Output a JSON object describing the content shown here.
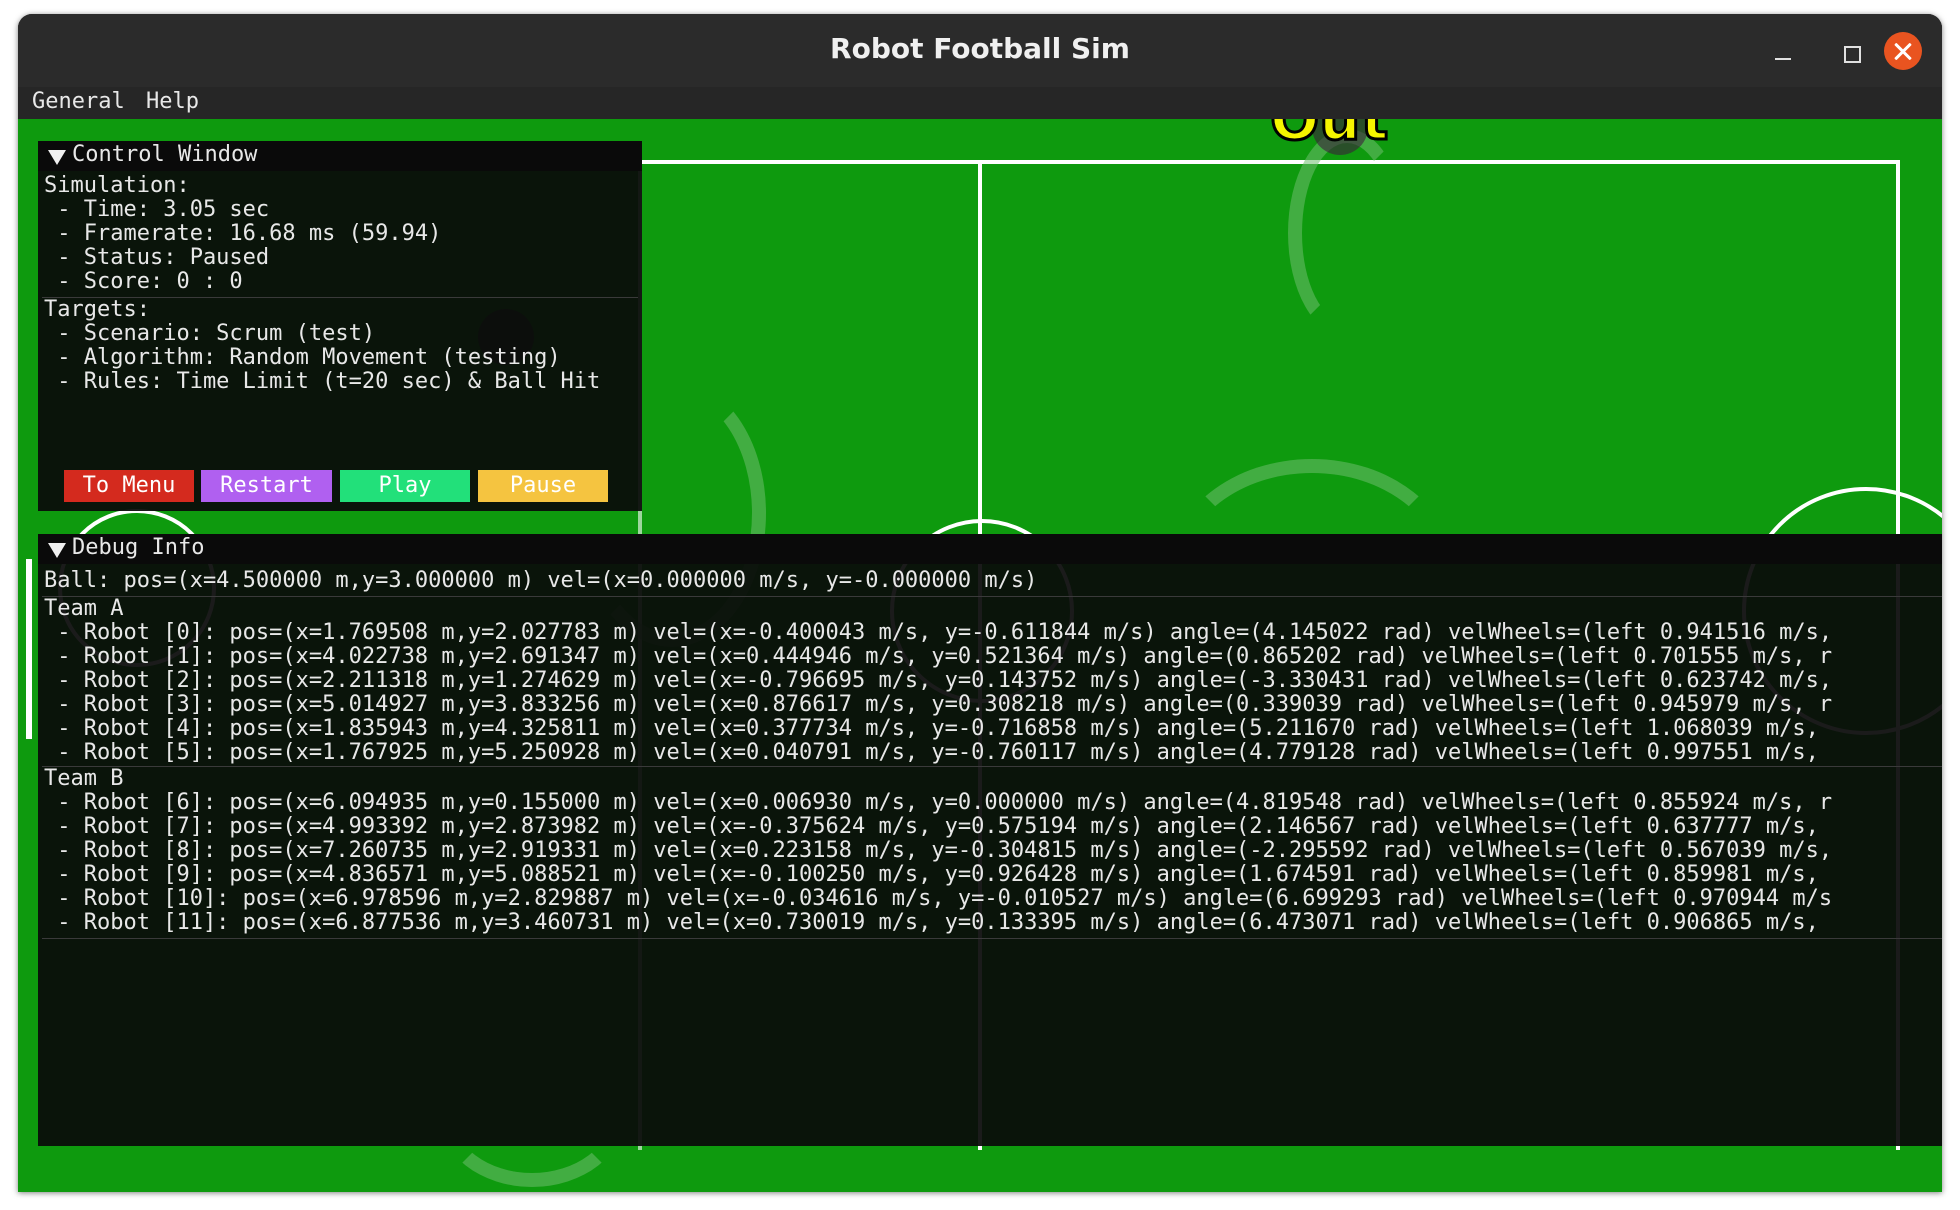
{
  "window": {
    "title": "Robot Football Sim"
  },
  "menubar": {
    "items": [
      "General",
      "Help"
    ]
  },
  "field": {
    "overlay_text": "Out"
  },
  "control": {
    "title": "Control Window",
    "simulation_label": "Simulation:",
    "time": " - Time: 3.05 sec",
    "framerate": " - Framerate: 16.68 ms (59.94)",
    "status": " - Status: Paused",
    "score": " - Score: 0 : 0",
    "targets_label": "Targets:",
    "scenario": " - Scenario: Scrum (test)",
    "algorithm": " - Algorithm: Random Movement (testing)",
    "rules": " - Rules: Time Limit (t=20 sec) & Ball Hit",
    "buttons": {
      "menu": "To Menu",
      "restart": "Restart",
      "play": "Play",
      "pause": "Pause"
    }
  },
  "debug": {
    "title": "Debug Info",
    "ball": "Ball: pos=(x=4.500000 m,y=3.000000 m) vel=(x=0.000000 m/s, y=-0.000000 m/s)",
    "team_a_label": "Team A",
    "team_a": [
      " - Robot [0]: pos=(x=1.769508 m,y=2.027783 m) vel=(x=-0.400043 m/s, y=-0.611844 m/s) angle=(4.145022 rad) velWheels=(left 0.941516 m/s,",
      " - Robot [1]: pos=(x=4.022738 m,y=2.691347 m) vel=(x=0.444946 m/s, y=0.521364 m/s) angle=(0.865202 rad) velWheels=(left 0.701555 m/s, r",
      " - Robot [2]: pos=(x=2.211318 m,y=1.274629 m) vel=(x=-0.796695 m/s, y=0.143752 m/s) angle=(-3.330431 rad) velWheels=(left 0.623742 m/s,",
      " - Robot [3]: pos=(x=5.014927 m,y=3.833256 m) vel=(x=0.876617 m/s, y=0.308218 m/s) angle=(0.339039 rad) velWheels=(left 0.945979 m/s, r",
      " - Robot [4]: pos=(x=1.835943 m,y=4.325811 m) vel=(x=0.377734 m/s, y=-0.716858 m/s) angle=(5.211670 rad) velWheels=(left 1.068039 m/s,",
      " - Robot [5]: pos=(x=1.767925 m,y=5.250928 m) vel=(x=0.040791 m/s, y=-0.760117 m/s) angle=(4.779128 rad) velWheels=(left 0.997551 m/s,"
    ],
    "team_b_label": "Team B",
    "team_b": [
      " - Robot [6]: pos=(x=6.094935 m,y=0.155000 m) vel=(x=0.006930 m/s, y=0.000000 m/s) angle=(4.819548 rad) velWheels=(left 0.855924 m/s, r",
      " - Robot [7]: pos=(x=4.993392 m,y=2.873982 m) vel=(x=-0.375624 m/s, y=0.575194 m/s) angle=(2.146567 rad) velWheels=(left 0.637777 m/s,",
      " - Robot [8]: pos=(x=7.260735 m,y=2.919331 m) vel=(x=0.223158 m/s, y=-0.304815 m/s) angle=(-2.295592 rad) velWheels=(left 0.567039 m/s,",
      " - Robot [9]: pos=(x=4.836571 m,y=5.088521 m) vel=(x=-0.100250 m/s, y=0.926428 m/s) angle=(1.674591 rad) velWheels=(left 0.859981 m/s,",
      " - Robot [10]: pos=(x=6.978596 m,y=2.829887 m) vel=(x=-0.034616 m/s, y=-0.010527 m/s) angle=(6.699293 rad) velWheels=(left 0.970944 m/s",
      " - Robot [11]: pos=(x=6.877536 m,y=3.460731 m) vel=(x=0.730019 m/s, y=0.133395 m/s) angle=(6.473071 rad) velWheels=(left 0.906865 m/s,"
    ]
  }
}
